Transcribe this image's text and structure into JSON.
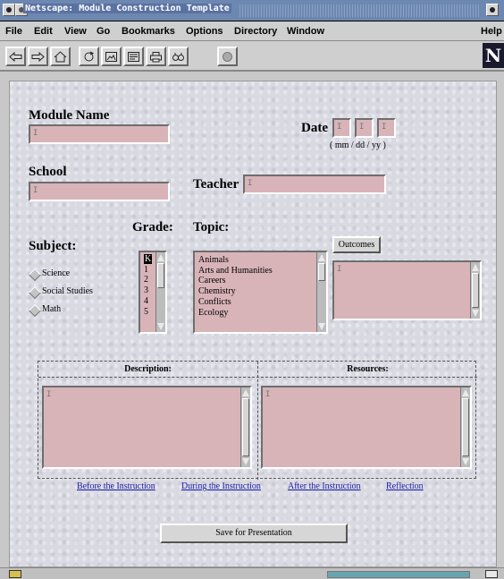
{
  "window": {
    "title": "Netscape: Module Construction Template"
  },
  "menu": [
    "File",
    "Edit",
    "View",
    "Go",
    "Bookmarks",
    "Options",
    "Directory",
    "Window",
    "Help"
  ],
  "toolbar": {
    "buttons": [
      "back-icon",
      "forward-icon",
      "home-icon",
      "reload-icon",
      "images-icon",
      "open-icon",
      "print-icon",
      "find-icon",
      "stop-icon"
    ],
    "logo": "N"
  },
  "form": {
    "module_name_label": "Module Name",
    "date_label": "Date",
    "date_format": "( mm / dd / yy )",
    "school_label": "School",
    "teacher_label": "Teacher",
    "grade_label": "Grade:",
    "topic_label": "Topic:",
    "subject_label": "Subject:",
    "outcomes_button": "Outcomes",
    "subjects": [
      "Science",
      "Social Studies",
      "Math"
    ],
    "grades": [
      "K",
      "1",
      "2",
      "3",
      "4",
      "5"
    ],
    "selected_grade": "K",
    "topics": [
      "Animals",
      "Arts and Humanities",
      "Careers",
      "Chemistry",
      "Conflicts",
      "Ecology"
    ],
    "description_header": "Description:",
    "resources_header": "Resources:",
    "links": [
      "Before the Instruction",
      "During the Instruction",
      "After the Instruction",
      "Reflection"
    ],
    "save_button": "Save for Presentation",
    "caret": "I"
  },
  "colors": {
    "field_bg": "#d8b4b8",
    "title_bar": "#6d88b0",
    "link": "#1a1aa6"
  }
}
